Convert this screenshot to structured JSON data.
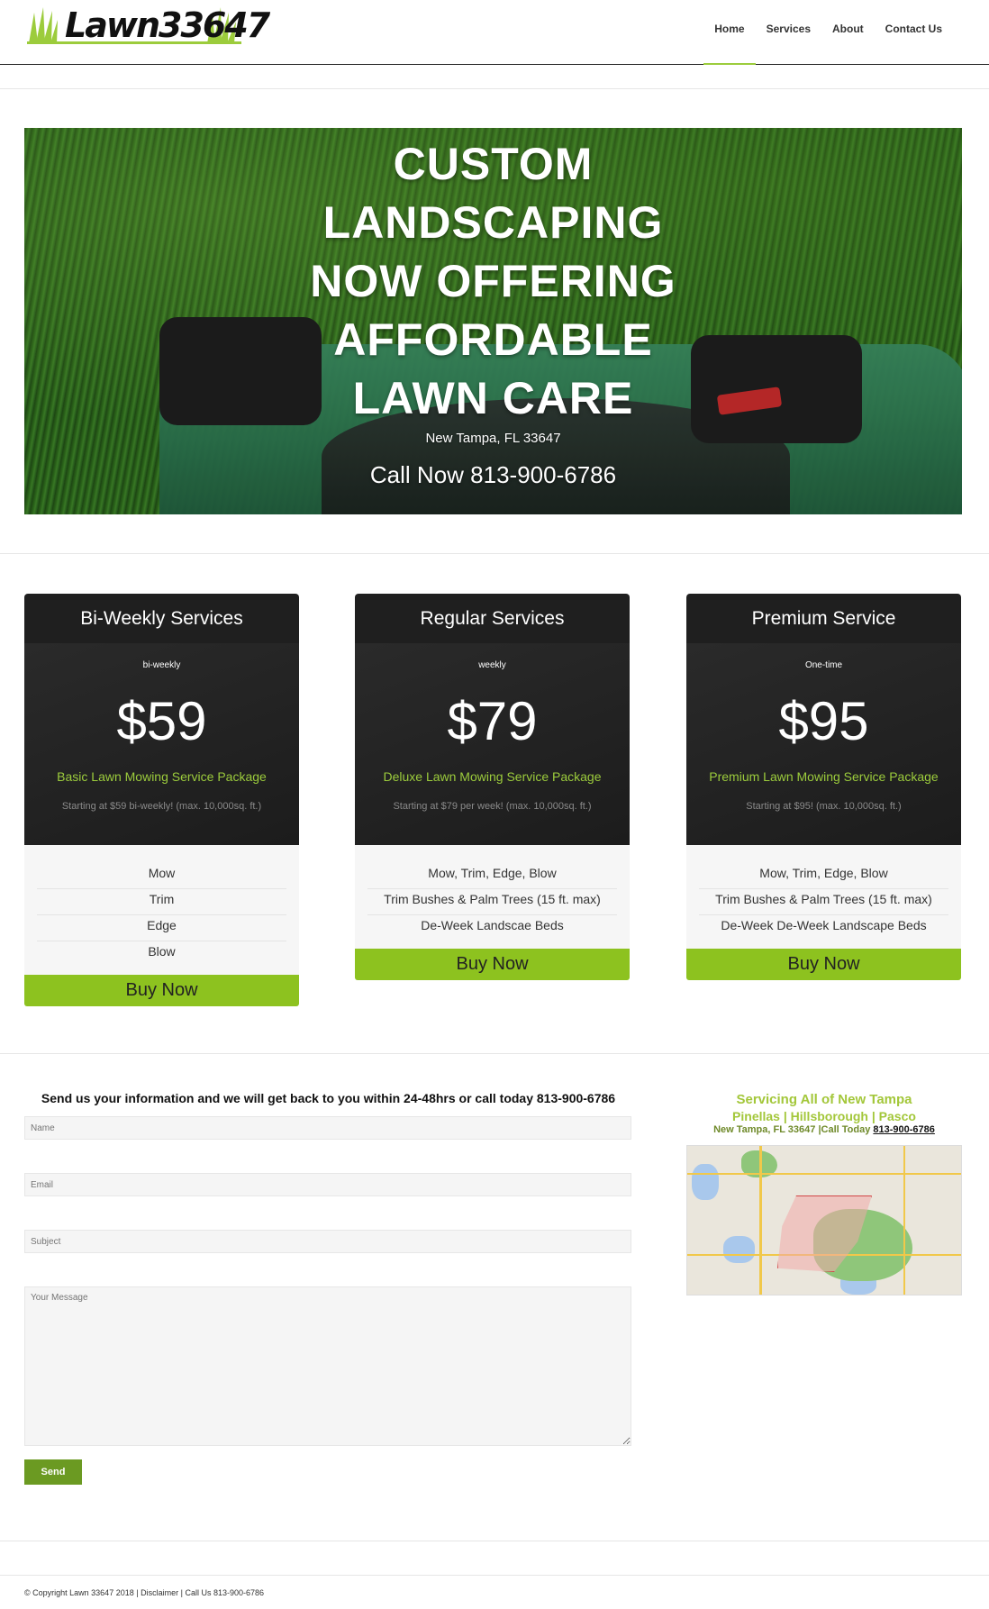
{
  "header": {
    "logo_text": "Lawn33647",
    "nav": [
      "Home",
      "Services",
      "About",
      "Contact Us"
    ],
    "active_nav": "Home"
  },
  "hero": {
    "title_lines": [
      "CUSTOM",
      "LANDSCAPING",
      "NOW OFFERING",
      "AFFORDABLE",
      "LAWN CARE"
    ],
    "location": "New Tampa, FL 33647",
    "call": "Call Now 813-900-6786"
  },
  "plans": [
    {
      "title": "Bi-Weekly Services",
      "period": "bi-weekly",
      "price": "$59",
      "name": "Basic Lawn Mowing Service Package",
      "note": "Starting at $59 bi-weekly! (max. 10,000sq. ft.)",
      "features": [
        "Mow",
        "Trim",
        "Edge",
        "Blow"
      ],
      "button": "Buy Now"
    },
    {
      "title": "Regular Services",
      "period": "weekly",
      "price": "$79",
      "name": "Deluxe Lawn Mowing Service Package",
      "note": "Starting at $79 per week! (max. 10,000sq. ft.)",
      "features": [
        "Mow, Trim, Edge, Blow",
        "Trim Bushes & Palm Trees (15 ft. max)",
        "De-Week Landscae Beds"
      ],
      "button": "Buy Now"
    },
    {
      "title": "Premium Service",
      "period": "One-time",
      "price": "$95",
      "name": "Premium Lawn Mowing Service Package",
      "note": "Starting at $95! (max. 10,000sq. ft.)",
      "features": [
        "Mow, Trim, Edge, Blow",
        "Trim Bushes & Palm Trees (15 ft. max)",
        "De-Week De-Week Landscape Beds"
      ],
      "button": "Buy Now"
    }
  ],
  "contact": {
    "title": "Send us your information and we will get back to you within 24-48hrs or call today 813-900-6786",
    "name_placeholder": "Name",
    "email_placeholder": "Email",
    "subject_placeholder": "Subject",
    "message_placeholder": "Your Message",
    "send_label": "Send"
  },
  "service_area": {
    "line1": "Servicing All of New Tampa",
    "line2": "Pinellas | Hillsborough | Pasco",
    "line3_prefix": "New Tampa, FL 33647 |Call Today",
    "phone": "813-900-6786"
  },
  "footer": {
    "copyright": "© Copyright Lawn 33647 2018 |",
    "disclaimer": "Disclaimer",
    "separator": "|",
    "call": "Call Us 813-900-6786"
  },
  "colors": {
    "accent_green": "#8dc21f",
    "dark_panel": "#1f1f1f",
    "send_button": "#6b9a22"
  }
}
